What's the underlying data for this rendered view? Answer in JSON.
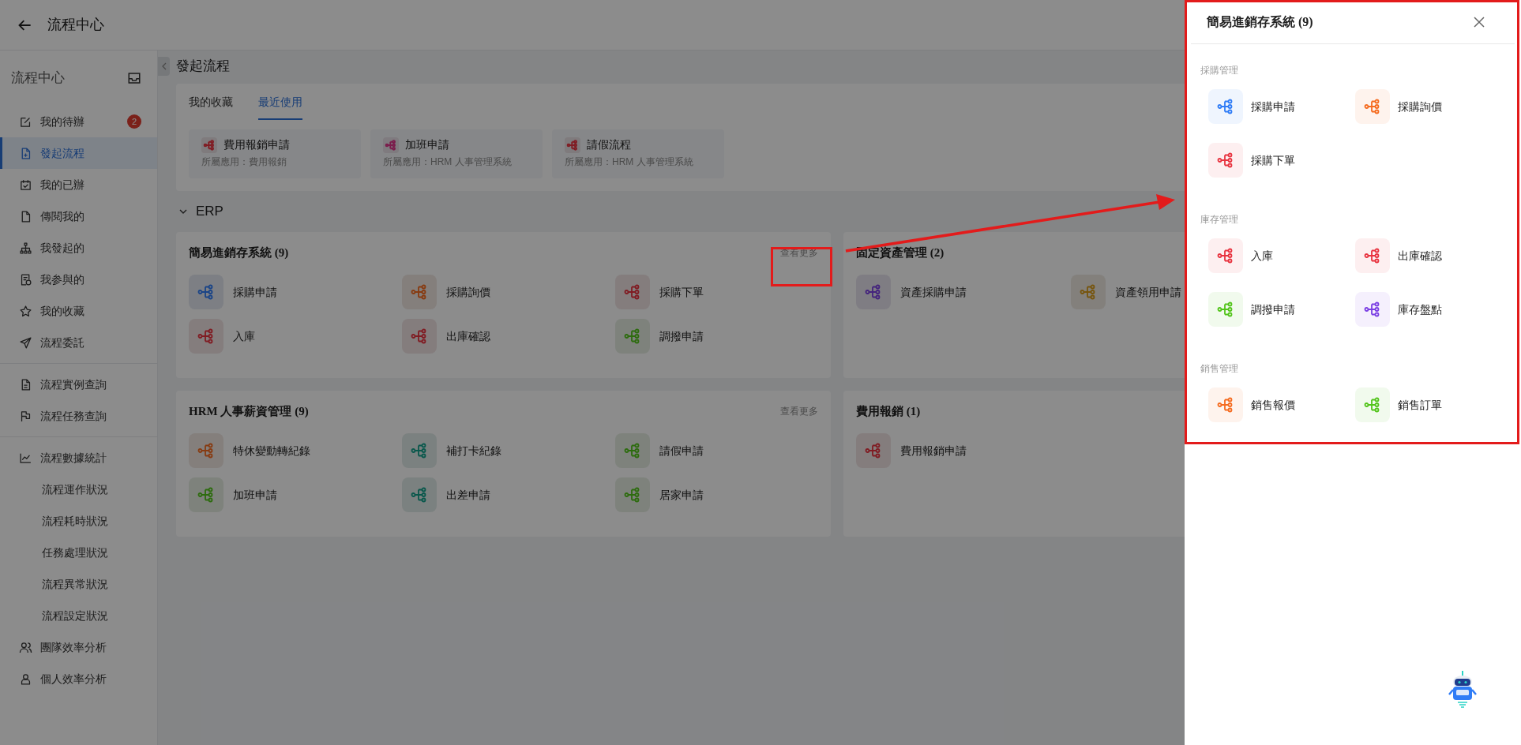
{
  "header": {
    "title": "流程中心"
  },
  "sidebar": {
    "title": "流程中心",
    "sections": [
      {
        "items": [
          {
            "label": "我的待辦",
            "selected": false,
            "badge": "2"
          },
          {
            "label": "發起流程",
            "selected": true
          },
          {
            "label": "我的已辦",
            "selected": false
          },
          {
            "label": "傳閱我的",
            "selected": false
          },
          {
            "label": "我發起的",
            "selected": false
          },
          {
            "label": "我参與的",
            "selected": false
          },
          {
            "label": "我的收藏",
            "selected": false
          },
          {
            "label": "流程委託",
            "selected": false
          }
        ]
      },
      {
        "items": [
          {
            "label": "流程實例查詢",
            "selected": false
          },
          {
            "label": "流程任務查詢",
            "selected": false
          }
        ]
      },
      {
        "items": [
          {
            "label": "流程數據統計",
            "selected": false,
            "children": [
              {
                "label": "流程運作狀況",
                "selected": false
              },
              {
                "label": "流程耗時狀況",
                "selected": false
              },
              {
                "label": "任務處理狀況",
                "selected": false
              },
              {
                "label": "流程異常狀況",
                "selected": false
              },
              {
                "label": "流程設定狀況",
                "selected": false
              }
            ]
          },
          {
            "label": "團隊效率分析",
            "selected": false
          },
          {
            "label": "個人效率分析",
            "selected": false
          }
        ]
      }
    ]
  },
  "main": {
    "title": "發起流程",
    "tabs": [
      {
        "label": "我的收藏",
        "selected": false
      },
      {
        "label": "最近使用",
        "selected": true
      }
    ],
    "recent": [
      {
        "title": "費用報銷申請",
        "app": "所屬應用：費用報銷",
        "color": "#801c23"
      },
      {
        "title": "加班申請",
        "app": "所屬應用：HRM 人事管理系統",
        "color": "#7b1c4c"
      },
      {
        "title": "請假流程",
        "app": "所屬應用：HRM 人事管理系統",
        "color": "#801c23"
      }
    ],
    "section": {
      "title": "ERP",
      "expanded": true
    },
    "cards": [
      {
        "title": "簡易進銷存系統 (9)",
        "more": "查看更多",
        "items": [
          {
            "label": "採購申請",
            "color": "#1a4487"
          },
          {
            "label": "採購詢價",
            "color": "#873b11"
          },
          {
            "label": "採購下單",
            "color": "#801c23"
          },
          {
            "label": "入庫",
            "color": "#801c23"
          },
          {
            "label": "出庫確認",
            "color": "#801c23"
          },
          {
            "label": "調撥申請",
            "color": "#2d6c0e"
          }
        ]
      },
      {
        "title": "固定資產管理 (2)",
        "items": [
          {
            "label": "資產採購申請",
            "color": "#44237d"
          },
          {
            "label": "資產領用申請",
            "color": "#77550e"
          }
        ]
      },
      {
        "title": "HRM 人事薪資管理 (9)",
        "more": "查看更多",
        "items": [
          {
            "label": "特休變動轉紀錄",
            "color": "#873b11"
          },
          {
            "label": "補打卡紀錄",
            "color": "#0a584c"
          },
          {
            "label": "請假申請",
            "color": "#2d6c0e"
          },
          {
            "label": "加班申請",
            "color": "#2d6c0e"
          },
          {
            "label": "出差申請",
            "color": "#0a584c"
          },
          {
            "label": "居家申請",
            "color": "#2d6c0e"
          }
        ]
      },
      {
        "title": "費用報銷 (1)",
        "items": [
          {
            "label": "費用報銷申請",
            "color": "#801c23"
          }
        ]
      }
    ]
  },
  "drawer": {
    "title": "簡易進銷存系統 (9)",
    "groups": [
      {
        "title": "採購管理",
        "items": [
          {
            "label": "採購申請",
            "color": "#2f7cf6"
          },
          {
            "label": "採購詢價",
            "color": "#f56b1f"
          },
          {
            "label": "採購下單",
            "color": "#e8333f"
          }
        ]
      },
      {
        "title": "庫存管理",
        "items": [
          {
            "label": "入庫",
            "color": "#e8333f"
          },
          {
            "label": "出庫確認",
            "color": "#e8333f"
          },
          {
            "label": "調撥申請",
            "color": "#52c41a"
          },
          {
            "label": "庫存盤點",
            "color": "#7b3fe4"
          }
        ]
      },
      {
        "title": "銷售管理",
        "items": [
          {
            "label": "銷售報價",
            "color": "#f56b1f"
          },
          {
            "label": "銷售訂單",
            "color": "#52c41a"
          }
        ]
      }
    ]
  }
}
